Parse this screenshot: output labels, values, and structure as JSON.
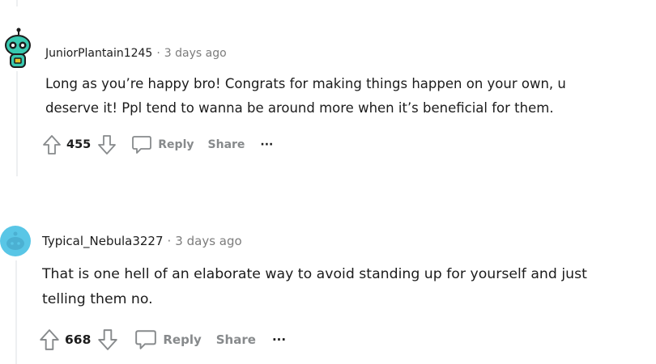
{
  "comments": [
    {
      "author": "JuniorPlantain1245",
      "separator": "·",
      "time": "3 days ago",
      "body": [
        "Long as you’re happy bro! Congrats for making things happen on your own, u",
        "deserve it! Ppl tend to wanna be around more when it’s beneficial for them."
      ],
      "votes": "455",
      "reply_label": "Reply",
      "share_label": "Share",
      "more_label": "···"
    },
    {
      "author": "Typical_Nebula3227",
      "separator": "·",
      "time": "3 days ago",
      "body": [
        "That is one hell of an elaborate way to avoid standing up for yourself and just",
        "telling them no."
      ],
      "votes": "668",
      "reply_label": "Reply",
      "share_label": "Share",
      "more_label": "···"
    }
  ],
  "colors": {
    "text": "#1c1c1c",
    "muted": "#7c7c7c",
    "icon": "#878a8c",
    "thread_line": "#edeff1",
    "avatar_teal": "#38c9b0",
    "avatar_blue": "#59c6e6"
  },
  "icons": {
    "avatar_1": "snoo-avatar-robot",
    "avatar_2": "snoo-avatar-default",
    "upvote": "arrow-up-icon",
    "downvote": "arrow-down-icon",
    "reply": "speech-bubble-icon",
    "more": "ellipsis-icon"
  }
}
